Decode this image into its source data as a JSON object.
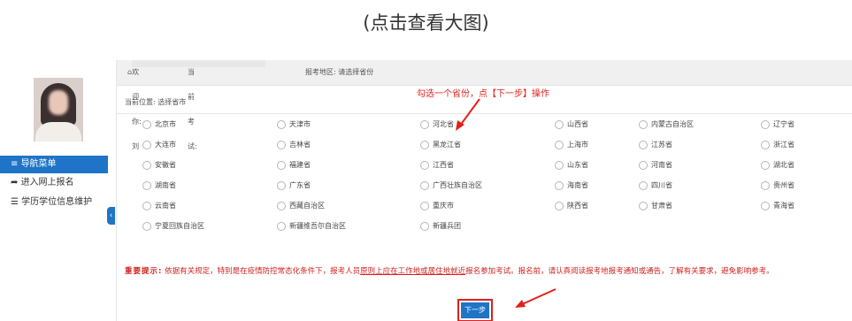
{
  "caption": "(点击查看大图)",
  "sidebar": {
    "items": [
      {
        "label": "导航菜单",
        "icon": "menu-icon",
        "active": true
      },
      {
        "label": "进入网上报名",
        "icon": "share-arrow-icon",
        "active": false
      },
      {
        "label": "学历学位信息维护",
        "icon": "list-icon",
        "active": false
      }
    ],
    "collapse_icon": "chevron-left-icon"
  },
  "topbar": {
    "welcome": "欢迎你: 刘",
    "exam": "当前考试:",
    "region": "报考地区: 请选择省份"
  },
  "location": "当前位置: 选择省市",
  "annotation": "勾选一个省份，点【下一步】操作",
  "provinces": [
    [
      "北京市",
      "天津市",
      "河北省",
      "山西省",
      "内蒙古自治区",
      "辽宁省"
    ],
    [
      "大连市",
      "吉林省",
      "黑龙江省",
      "上海市",
      "江苏省",
      "浙江省"
    ],
    [
      "安徽省",
      "福建省",
      "江西省",
      "山东省",
      "河南省",
      "湖北省"
    ],
    [
      "湖南省",
      "广东省",
      "广西壮族自治区",
      "海南省",
      "四川省",
      "贵州省"
    ],
    [
      "云南省",
      "西藏自治区",
      "重庆市",
      "陕西省",
      "甘肃省",
      "青海省"
    ],
    [
      "宁夏回族自治区",
      "新疆维吾尔自治区",
      "新疆兵团"
    ]
  ],
  "notice": {
    "title": "重要提示:",
    "text_before": "依据有关规定，特别是在疫情防控常态化条件下，报考人员",
    "text_underlined": "原则上应在工作地或居住地就近",
    "text_after": "报名参加考试。报名前，请认真阅读报考地报考通知或通告，了解有关要求，避免影响参考。"
  },
  "next_button": "下一步",
  "colors": {
    "accent": "#1f74c7",
    "annotation_red": "#e0201b"
  }
}
